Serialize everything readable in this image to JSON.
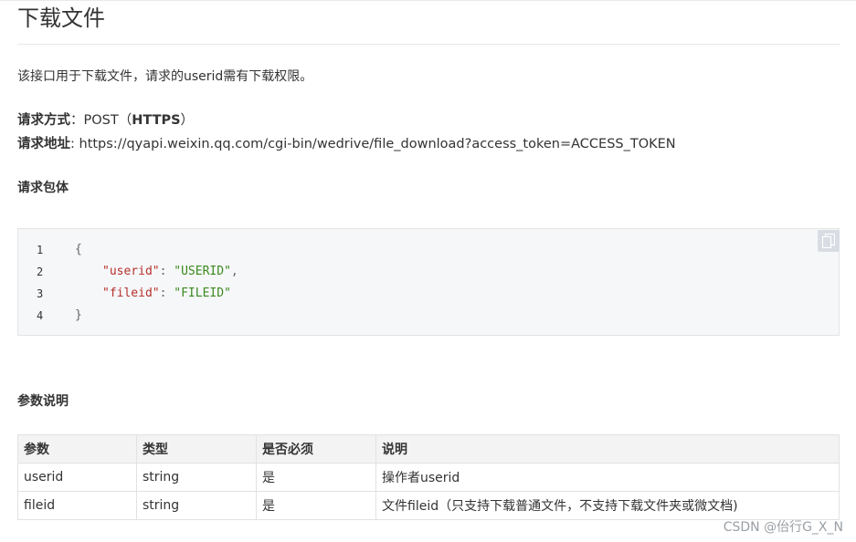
{
  "title": "下载文件",
  "description": "该接口用于下载文件，请求的userid需有下载权限。",
  "request": {
    "method_label": "请求方式",
    "method_sep": "：",
    "method_value": "POST（",
    "method_protocol": "HTTPS",
    "method_close": "）",
    "url_label": "请求地址",
    "url_sep": ": ",
    "url_value": "https://qyapi.weixin.qq.com/cgi-bin/wedrive/file_download?access_token=ACCESS_TOKEN"
  },
  "body_heading": "请求包体",
  "code": {
    "line_numbers": [
      "1",
      "2",
      "3",
      "4"
    ],
    "open_brace": "{",
    "close_brace": "}",
    "fields": [
      {
        "key": "\"userid\"",
        "value": "\"USERID\"",
        "trail": ","
      },
      {
        "key": "\"fileid\"",
        "value": "\"FILEID\"",
        "trail": ""
      }
    ],
    "copy_icon": "copy-icon"
  },
  "params_heading": "参数说明",
  "params_table": {
    "headers": [
      "参数",
      "类型",
      "是否必须",
      "说明"
    ],
    "rows": [
      [
        "userid",
        "string",
        "是",
        "操作者userid"
      ],
      [
        "fileid",
        "string",
        "是",
        "文件fileid（只支持下载普通文件，不支持下载文件夹或微文档)"
      ]
    ]
  },
  "watermark": "CSDN @佁行G_X_N"
}
